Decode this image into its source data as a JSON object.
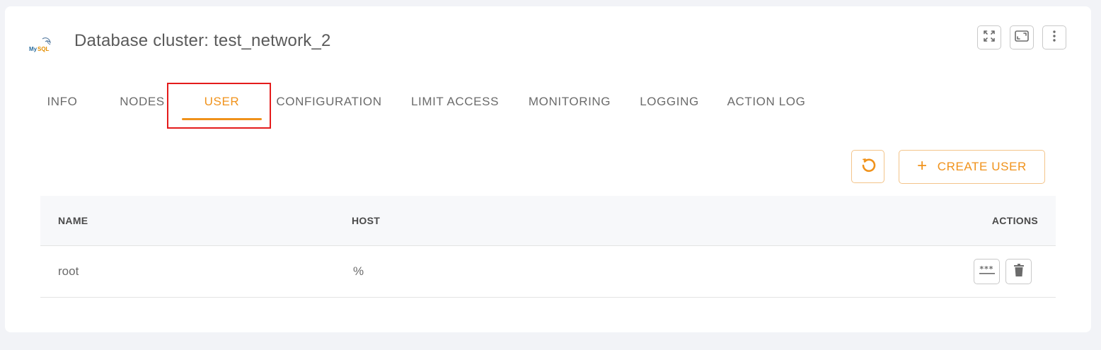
{
  "header": {
    "logo_text": "MySQL",
    "title": "Database cluster: test_network_2",
    "buttons": {
      "expand_icon": "expand-arrows-icon",
      "window_icon": "window-frame-icon",
      "menu_icon": "vertical-dots-icon"
    }
  },
  "tabs": [
    {
      "label": "INFO",
      "active": false
    },
    {
      "label": "NODES",
      "active": false
    },
    {
      "label": "USER",
      "active": true
    },
    {
      "label": "CONFIGURATION",
      "active": false
    },
    {
      "label": "LIMIT ACCESS",
      "active": false
    },
    {
      "label": "MONITORING",
      "active": false
    },
    {
      "label": "LOGGING",
      "active": false
    },
    {
      "label": "ACTION LOG",
      "active": false
    }
  ],
  "toolbar": {
    "refresh_icon": "refresh-icon",
    "create_user_plus": "+",
    "create_user_label": "CREATE USER"
  },
  "table": {
    "columns": {
      "name": "NAME",
      "host": "HOST",
      "actions": "ACTIONS"
    },
    "rows": [
      {
        "name": "root",
        "host": "%"
      }
    ],
    "row_actions": {
      "password_icon": "password-dots-icon",
      "delete_icon": "trash-icon"
    }
  },
  "colors": {
    "accent": "#f0921b",
    "highlight": "#e41b1b",
    "text": "#6b6b6b",
    "background": "#f2f3f7"
  }
}
